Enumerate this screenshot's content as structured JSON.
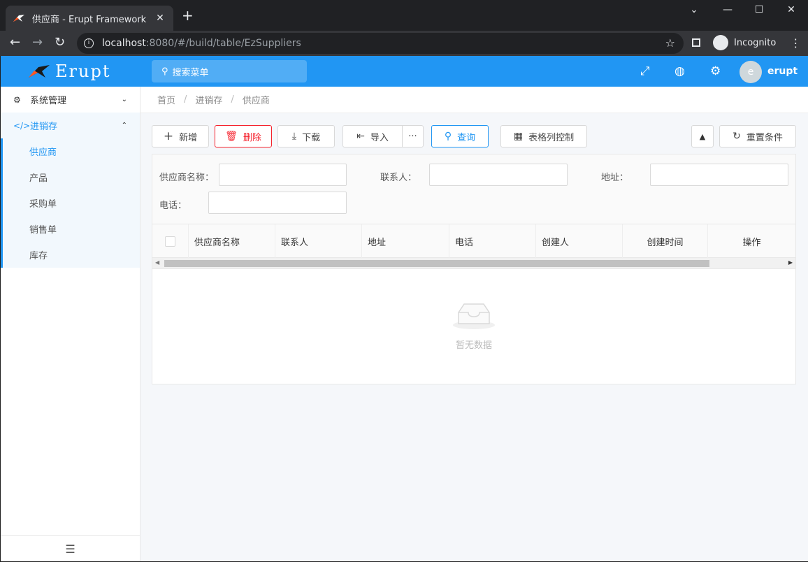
{
  "browser": {
    "tab_title": "供应商 - Erupt Framework",
    "new_tab": "+",
    "url_host": "localhost",
    "url_path": ":8080/#/build/table/EzSuppliers",
    "profile_label": "Incognito"
  },
  "header": {
    "logo_text": "Erupt",
    "search_placeholder": "搜索菜单",
    "avatar_letter": "e",
    "username": "erupt"
  },
  "sidebar": {
    "groups": [
      {
        "label": "系统管理"
      },
      {
        "label": "进销存"
      }
    ],
    "items": [
      {
        "label": "供应商"
      },
      {
        "label": "产品"
      },
      {
        "label": "采购单"
      },
      {
        "label": "销售单"
      },
      {
        "label": "库存"
      }
    ]
  },
  "breadcrumb": [
    "首页",
    "进销存",
    "供应商"
  ],
  "toolbar": {
    "add": "新增",
    "delete": "删除",
    "download": "下载",
    "import": "导入",
    "more": "···",
    "query": "查询",
    "columns": "表格列控制",
    "reset": "重置条件"
  },
  "filters": {
    "supplier_name": "供应商名称：",
    "contact": "联系人：",
    "address": "地址：",
    "phone": "电话："
  },
  "table": {
    "columns": [
      "供应商名称",
      "联系人",
      "地址",
      "电话",
      "创建人",
      "创建时间",
      "操作"
    ],
    "empty_text": "暂无数据"
  },
  "colors": {
    "brand": "#2196f3",
    "danger": "#f5222d"
  }
}
